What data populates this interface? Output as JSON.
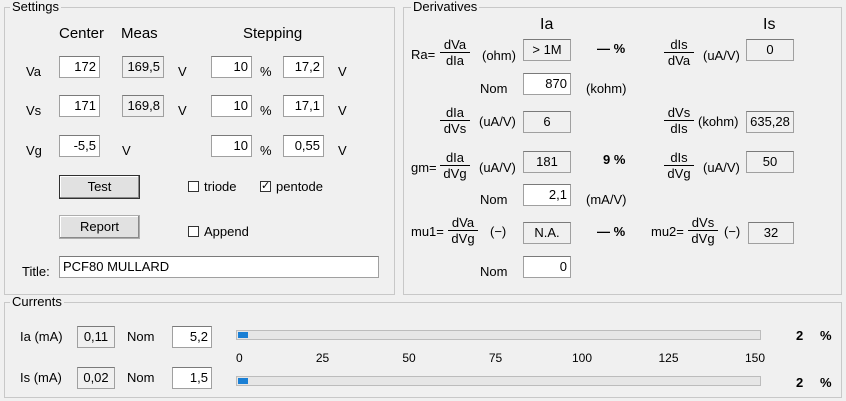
{
  "settings": {
    "title": "Settings",
    "col_center": "Center",
    "col_meas": "Meas",
    "col_stepping": "Stepping",
    "rows": [
      {
        "label": "Va",
        "center": "172",
        "meas": "169,5",
        "unit": "V",
        "step_pct": "10",
        "pct": "%",
        "step_val": "17,2",
        "step_unit": "V"
      },
      {
        "label": "Vs",
        "center": "171",
        "meas": "169,8",
        "unit": "V",
        "step_pct": "10",
        "pct": "%",
        "step_val": "17,1",
        "step_unit": "V"
      },
      {
        "label": "Vg",
        "center": "-5,5",
        "meas": "",
        "unit": "V",
        "step_pct": "10",
        "pct": "%",
        "step_val": "0,55",
        "step_unit": "V"
      }
    ],
    "test_label": "Test",
    "report_label": "Report",
    "triode_label": "triode",
    "triode_checked": false,
    "pentode_label": "pentode",
    "pentode_checked": true,
    "append_label": "Append",
    "append_checked": false,
    "title_label": "Title:",
    "title_value": "PCF80 MULLARD"
  },
  "derivatives": {
    "title": "Derivatives",
    "col_ia": "Ia",
    "col_is": "Is",
    "ra_label": "Ra=",
    "ra_num": "dVa",
    "ra_den": "dIa",
    "ra_unit": "(ohm)",
    "ra_value": "> 1M",
    "ra_pct": "—  %",
    "ra_nom_label": "Nom",
    "ra_nom_value": "870",
    "ra_nom_unit": "(kohm)",
    "dis_dva_num": "dIs",
    "dis_dva_den": "dVa",
    "dis_dva_unit": "(uA/V)",
    "dis_dva_value": "0",
    "dia_dvs_num": "dIa",
    "dia_dvs_den": "dVs",
    "dia_dvs_unit": "(uA/V)",
    "dia_dvs_value": "6",
    "dvs_dis_num": "dVs",
    "dvs_dis_den": "dIs",
    "dvs_dis_unit": "(kohm)",
    "dvs_dis_value": "635,28",
    "gm_label": "gm=",
    "gm_num": "dIa",
    "gm_den": "dVg",
    "gm_unit": "(uA/V)",
    "gm_value": "181",
    "gm_pct": "9  %",
    "dis_dvg_num": "dIs",
    "dis_dvg_den": "dVg",
    "dis_dvg_unit": "(uA/V)",
    "dis_dvg_value": "50",
    "gm_nom_label": "Nom",
    "gm_nom_value": "2,1",
    "gm_nom_unit": "(mA/V)",
    "mu1_label": "mu1=",
    "mu1_num": "dVa",
    "mu1_den": "dVg",
    "mu1_unit": "(−)",
    "mu1_value": "N.A.",
    "mu1_pct": "—  %",
    "mu2_label": "mu2=",
    "mu2_num": "dVs",
    "mu2_den": "dVg",
    "mu2_unit": "(−)",
    "mu2_value": "32",
    "mu1_nom_label": "Nom",
    "mu1_nom_value": "0"
  },
  "currents": {
    "title": "Currents",
    "ia_label": "Ia (mA)",
    "ia_value": "0,11",
    "ia_nom_label": "Nom",
    "ia_nom_value": "5,2",
    "ia_pct_value": "2",
    "ia_pct_sign": "%",
    "is_label": "Is (mA)",
    "is_value": "0,02",
    "is_nom_label": "Nom",
    "is_nom_value": "1,5",
    "is_pct_value": "2",
    "is_pct_sign": "%",
    "scale_min": 0,
    "scale_max": 150,
    "scale_ticks": [
      "0",
      "25",
      "50",
      "75",
      "100",
      "125",
      "150"
    ],
    "ia_bar_fraction": 0.02,
    "is_bar_fraction": 0.02,
    "bar_color": "#1a7fd4"
  }
}
